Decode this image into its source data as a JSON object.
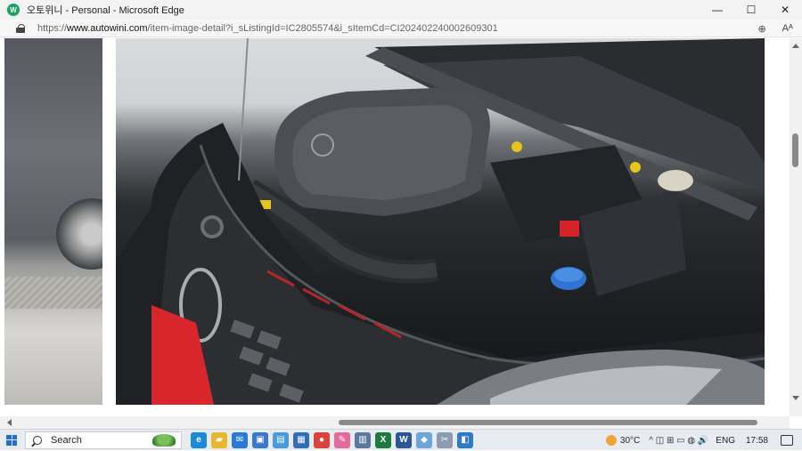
{
  "window": {
    "title": "오토위니 - Personal - Microsoft Edge",
    "app_icon_letter": "W",
    "minimize": "—",
    "maximize": "☐",
    "close": "✕"
  },
  "address": {
    "url_prefix": "https://",
    "url_domain": "www.autowini.com",
    "url_path": "/item-image-detail?i_sListingId=IC2805574&i_sItemCd=CI202402240002609301",
    "zoom_icon": "⊕",
    "read_aloud_icon": "Aᴬ"
  },
  "taskbar": {
    "search_label": "Search",
    "apps": [
      {
        "name": "edge-icon",
        "glyph": "e",
        "color": "#1b8bd6"
      },
      {
        "name": "file-explorer-icon",
        "glyph": "▰",
        "color": "#e8b730"
      },
      {
        "name": "mail-icon",
        "glyph": "✉",
        "color": "#2a7bd4"
      },
      {
        "name": "store-icon",
        "glyph": "▣",
        "color": "#3a78c8"
      },
      {
        "name": "photos-icon",
        "glyph": "▤",
        "color": "#4a9bd8"
      },
      {
        "name": "onscreen-icon",
        "glyph": "▦",
        "color": "#2e6fb8"
      },
      {
        "name": "chrome-icon",
        "glyph": "●",
        "color": "#d9453a"
      },
      {
        "name": "paint-icon",
        "glyph": "✎",
        "color": "#e26a9c"
      },
      {
        "name": "calculator-icon",
        "glyph": "▥",
        "color": "#5b7a9a"
      },
      {
        "name": "excel-icon",
        "glyph": "X",
        "color": "#1f7a3f"
      },
      {
        "name": "word-icon",
        "glyph": "W",
        "color": "#2b579a"
      },
      {
        "name": "tool-icon",
        "glyph": "◆",
        "color": "#6aa7d8"
      },
      {
        "name": "snip-icon",
        "glyph": "✂",
        "color": "#8c9bb0"
      },
      {
        "name": "image-viewer-icon",
        "glyph": "◧",
        "color": "#2f7ac6"
      }
    ],
    "weather_temp": "30°C",
    "tray_symbols": "^ ◫ ⊞ ▭ ◍ 🔊",
    "language": "ENG",
    "time": "17:58"
  }
}
